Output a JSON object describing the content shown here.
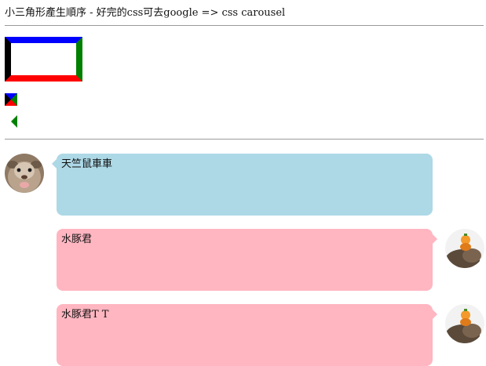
{
  "heading": "小三角形產生順序 - 好完的css可去google => css carousel",
  "colors": {
    "border_top": "#0000ff",
    "border_right": "#008000",
    "border_bottom": "#ff0000",
    "border_left": "#000000",
    "bubble_blue": "#add8e6",
    "bubble_pink": "#ffb6c1"
  },
  "chat": {
    "messages": [
      {
        "side": "left",
        "avatar": "guinea-pig-avatar",
        "text": "天竺鼠車車"
      },
      {
        "side": "right",
        "avatar": "capybara-orange-avatar",
        "text": "水豚君"
      },
      {
        "side": "right",
        "avatar": "capybara-orange-avatar",
        "text": "水豚君T T"
      }
    ]
  }
}
